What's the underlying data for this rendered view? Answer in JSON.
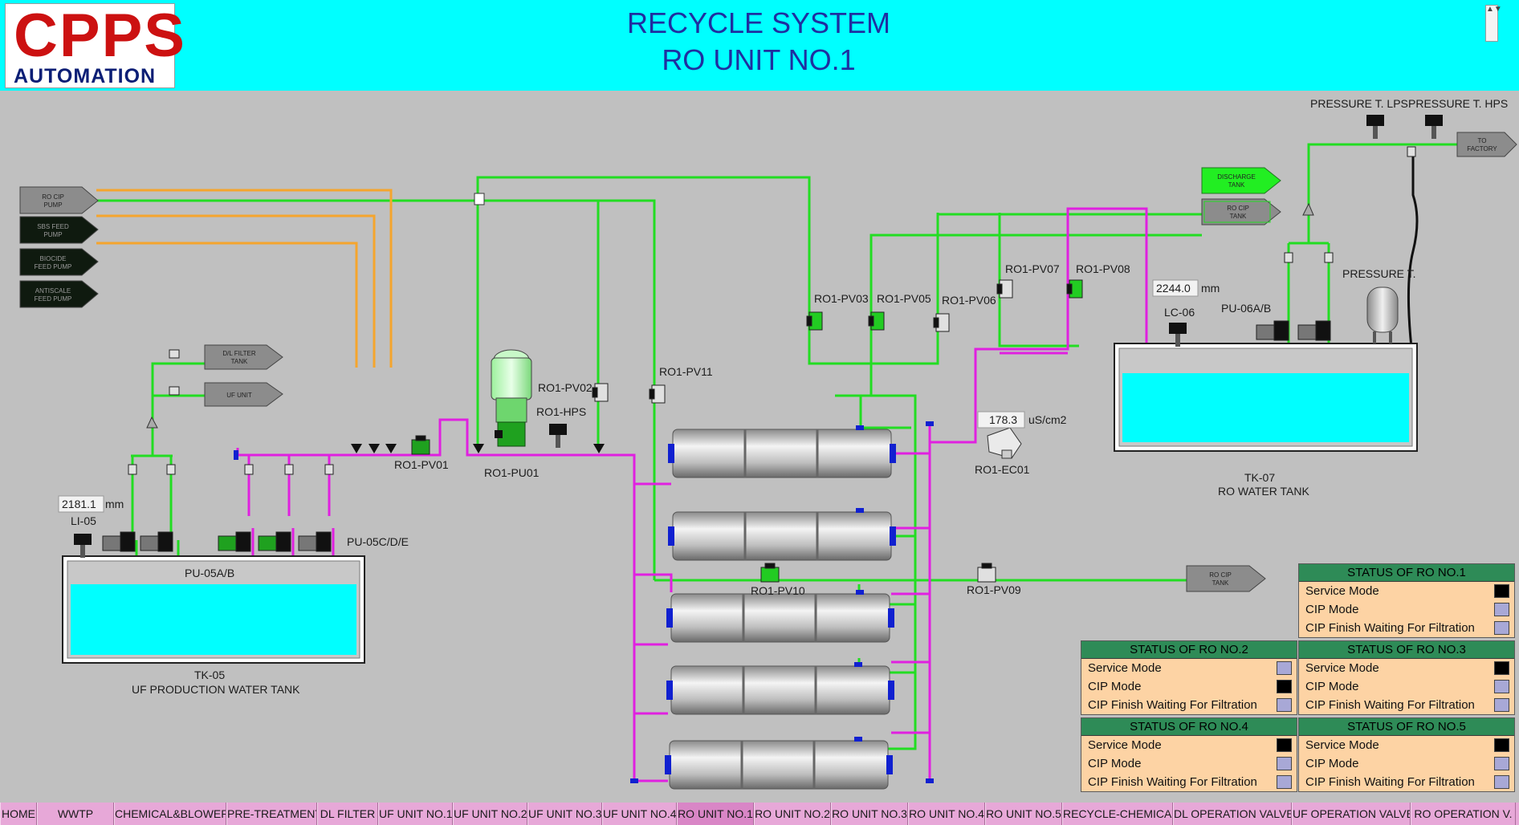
{
  "header": {
    "logo_top": "CPPS",
    "logo_bottom": "AUTOMATION",
    "title_line1": "RECYCLE SYSTEM",
    "title_line2": "RO UNIT NO.1",
    "scroll_icons": "▲▼"
  },
  "colors": {
    "header_bg": "#00ffff",
    "workspace_bg": "#c0c0c0",
    "line_green": "#22dd22",
    "line_orange": "#f5a52d",
    "line_magenta": "#e020e0",
    "water": "#00ffff",
    "panel_title_bg": "#2e8b57",
    "panel_body_bg": "#fdd3a4",
    "nav_bg": "#e7a8d8"
  },
  "sources": {
    "ro_cip_pump": "RO CIP PUMP",
    "sbs_feed_pump": "SBS FEED PUMP",
    "biocide_feed_pump": "BIOCIDE FEED PUMP",
    "antiscale_feed_pump": "ANTISCALE FEED PUMP",
    "dl_filter_tank": "D/L FILTER TANK",
    "uf_unit": "UF UNIT",
    "discharge_tank": "DISCHARGE TANK",
    "ro_cip_tank_top": "RO CIP TANK",
    "ro_cip_tank_bottom": "RO CIP TANK",
    "to_factory": "TO FACTORY"
  },
  "tanks": {
    "tk05": {
      "tag": "TK-05",
      "name": "UF PRODUCTION WATER TANK",
      "level_value": "2181.1",
      "level_unit": "mm",
      "level_tag": "LI-05",
      "pumps_ab": "PU-05A/B",
      "pumps_cde": "PU-05C/D/E"
    },
    "tk07": {
      "tag": "TK-07",
      "name": "RO WATER TANK",
      "level_value": "2244.0",
      "level_unit": "mm",
      "level_tag": "LC-06",
      "pumps": "PU-06A/B",
      "pressure_tank": "PRESSURE T."
    }
  },
  "instruments": {
    "pressure_lps": "PRESSURE T. LPS",
    "pressure_hps": "PRESSURE T. HPS",
    "ec_value": "178.3",
    "ec_unit": "uS/cm2",
    "ec_tag": "RO1-EC01",
    "hps": "RO1-HPS",
    "pump": "RO1-PU01"
  },
  "valves": [
    "RO1-PV01",
    "RO1-PV02",
    "RO1-PV03",
    "RO1-PV05",
    "RO1-PV06",
    "RO1-PV07",
    "RO1-PV08",
    "RO1-PV09",
    "RO1-PV10",
    "RO1-PV11"
  ],
  "status_panels": [
    {
      "title": "STATUS OF RO NO.1",
      "rows": [
        {
          "label": "Service Mode",
          "state": "#000000"
        },
        {
          "label": "CIP Mode",
          "state": "#a8a8d6"
        },
        {
          "label": "CIP Finish Waiting For Filtration",
          "state": "#a8a8d6"
        }
      ]
    },
    {
      "title": "STATUS OF RO NO.2",
      "rows": [
        {
          "label": "Service Mode",
          "state": "#a8a8d6"
        },
        {
          "label": "CIP Mode",
          "state": "#000000"
        },
        {
          "label": "CIP Finish Waiting For Filtration",
          "state": "#a8a8d6"
        }
      ]
    },
    {
      "title": "STATUS OF RO NO.3",
      "rows": [
        {
          "label": "Service Mode",
          "state": "#000000"
        },
        {
          "label": "CIP Mode",
          "state": "#a8a8d6"
        },
        {
          "label": "CIP Finish Waiting For Filtration",
          "state": "#a8a8d6"
        }
      ]
    },
    {
      "title": "STATUS OF RO NO.4",
      "rows": [
        {
          "label": "Service Mode",
          "state": "#000000"
        },
        {
          "label": "CIP Mode",
          "state": "#a8a8d6"
        },
        {
          "label": "CIP Finish Waiting For Filtration",
          "state": "#a8a8d6"
        }
      ]
    },
    {
      "title": "STATUS OF RO NO.5",
      "rows": [
        {
          "label": "Service Mode",
          "state": "#000000"
        },
        {
          "label": "CIP Mode",
          "state": "#a8a8d6"
        },
        {
          "label": "CIP Finish Waiting For Filtration",
          "state": "#a8a8d6"
        }
      ]
    }
  ],
  "nav": [
    "HOME",
    "WWTP",
    "CHEMICAL&BLOWER",
    "PRE-TREATMENT",
    "DL FILTER",
    "UF UNIT NO.1",
    "UF UNIT NO.2",
    "UF UNIT NO.3",
    "UF UNIT NO.4",
    "RO UNIT NO.1",
    "RO UNIT NO.2",
    "RO UNIT NO.3",
    "RO UNIT NO.4",
    "RO UNIT NO.5",
    "RECYCLE-CHEMICAL",
    "DL OPERATION VALVE",
    "UF OPERATION VALVE",
    "RO OPERATION V."
  ]
}
